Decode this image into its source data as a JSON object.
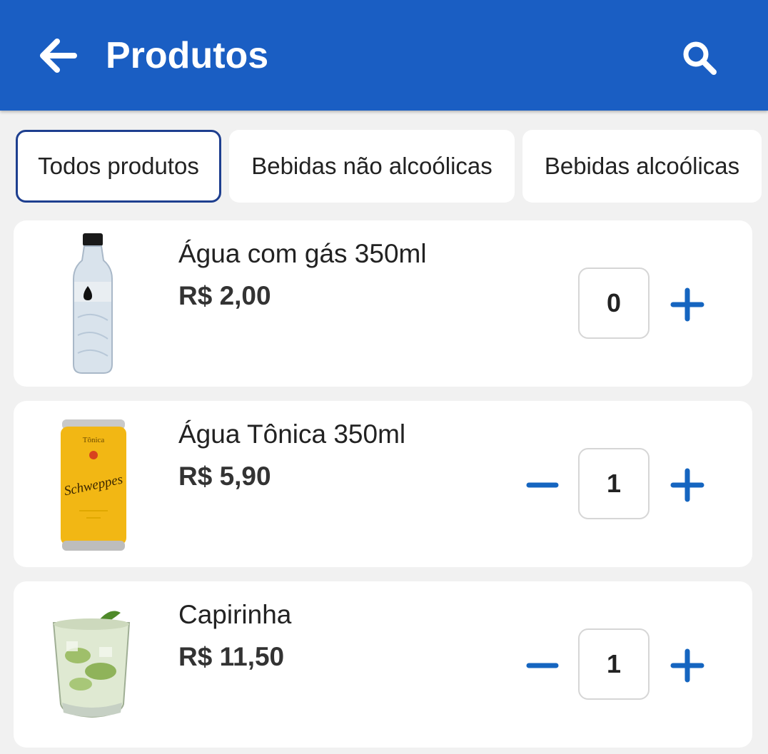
{
  "colors": {
    "primary": "#1a5ec3",
    "accent_icon": "#1565c0",
    "background": "#f1f1f1"
  },
  "header": {
    "title": "Produtos",
    "back_icon": "arrow-left-icon",
    "search_icon": "search-icon"
  },
  "tabs": [
    {
      "label": "Todos produtos",
      "active": true
    },
    {
      "label": "Bebidas não alcoólicas",
      "active": false
    },
    {
      "label": "Bebidas alcoólicas",
      "active": false
    }
  ],
  "products": [
    {
      "name": "Água com gás 350ml",
      "price": "R$ 2,00",
      "quantity": "0",
      "image": "sparkling-water-bottle"
    },
    {
      "name": "Água Tônica 350ml",
      "price": "R$ 5,90",
      "quantity": "1",
      "image": "tonic-water-can",
      "can_text": "Tônica",
      "can_brand": "Schweppes"
    },
    {
      "name": "Capirinha",
      "price": "R$ 11,50",
      "quantity": "1",
      "image": "caipirinha-glass"
    }
  ]
}
